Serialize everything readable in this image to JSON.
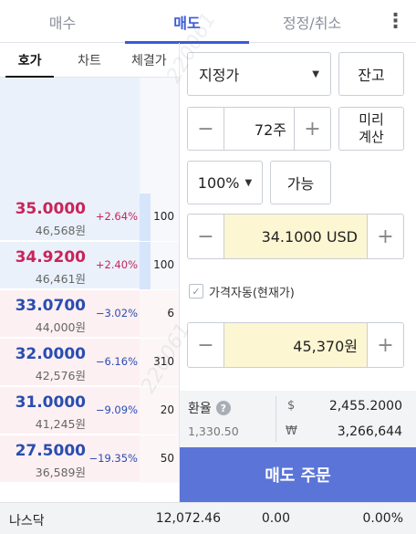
{
  "top_tabs": [
    {
      "label": "매수"
    },
    {
      "label": "매도"
    },
    {
      "label": "정정/취소"
    }
  ],
  "menu_icon": "more-vertical-icon",
  "sub_tabs": [
    {
      "label": "호가"
    },
    {
      "label": "차트"
    },
    {
      "label": "체결가"
    }
  ],
  "order_book": {
    "sell": [
      {
        "price": "35.0000",
        "krw": "46,568원",
        "rate": "+2.64%",
        "qty": "100"
      },
      {
        "price": "34.9200",
        "krw": "46,461원",
        "rate": "+2.40%",
        "qty": "100"
      }
    ],
    "buy": [
      {
        "price": "33.0700",
        "krw": "44,000원",
        "rate": "−3.02%",
        "qty": "6"
      },
      {
        "price": "32.0000",
        "krw": "42,576원",
        "rate": "−6.16%",
        "qty": "310"
      },
      {
        "price": "31.0000",
        "krw": "41,245원",
        "rate": "−9.09%",
        "qty": "20"
      },
      {
        "price": "27.5000",
        "krw": "36,589원",
        "rate": "−19.35%",
        "qty": "50"
      }
    ]
  },
  "order_form": {
    "order_type": "지정가",
    "balance_button": "잔고",
    "quantity": "72주",
    "precalc_line1": "미리",
    "precalc_line2": "계산",
    "percent": "100%",
    "available_button": "가능",
    "price_usd": "34.1000 USD",
    "auto_price_label": "가격자동(현재가)",
    "price_krw": "45,370원"
  },
  "fx": {
    "label": "환율",
    "rate": "1,330.50",
    "usd_symbol": "$",
    "usd_value": "2,455.2000",
    "krw_symbol": "₩",
    "krw_value": "3,266,644"
  },
  "sell_button": "매도 주문",
  "ticker": {
    "name": "나스닥",
    "index": "12,072.46",
    "change": "0.00",
    "percent": "0.00%"
  },
  "watermark": "220061"
}
